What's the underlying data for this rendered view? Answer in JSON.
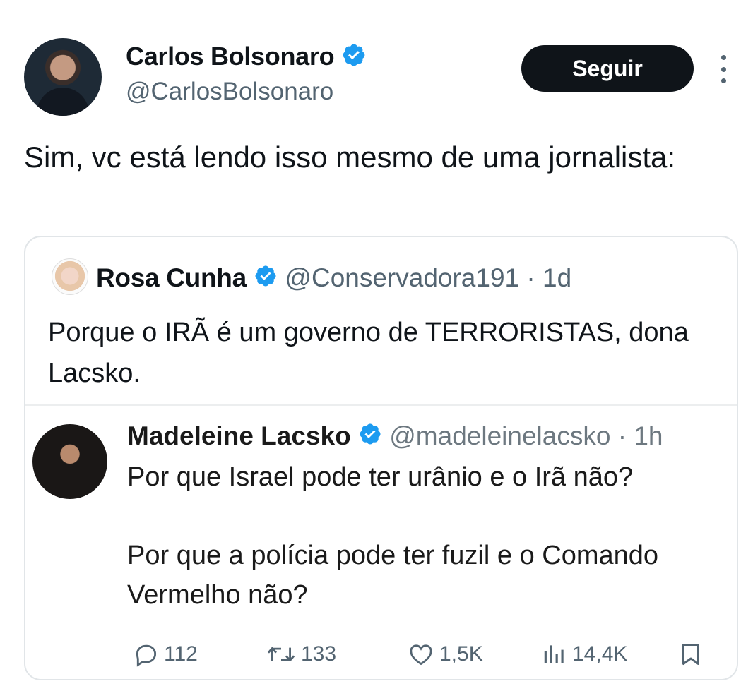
{
  "tweet": {
    "author_name": "Carlos Bolsonaro",
    "author_handle": "@CarlosBolsonaro",
    "follow_label": "Seguir",
    "text": "Sim, vc está lendo isso mesmo de uma jornalista:"
  },
  "quote": {
    "author_name": "Rosa Cunha",
    "author_handle": "@Conservadora191",
    "separator": "·",
    "time": "1d",
    "text": "Porque o IRÃ é um governo de TERRORISTAS, dona Lacsko."
  },
  "embedded": {
    "author_name": "Madeleine Lacsko",
    "author_handle": "@madeleinelacsko",
    "separator": "·",
    "time": "1h",
    "text_1": "Por que Israel pode ter urânio e o Irã não?",
    "text_2": "Por que a polícia pode ter fuzil e o Comando Vermelho não?",
    "actions": {
      "replies": "112",
      "reposts": "133",
      "likes": "1,5K",
      "views": "14,4K"
    }
  },
  "colors": {
    "verified_blue": "#1d9bf0",
    "text_primary": "#0f1419",
    "text_secondary": "#536471",
    "button_bg": "#0f1419"
  },
  "icons": [
    "verified-badge-icon",
    "more-options-icon",
    "reply-icon",
    "repost-icon",
    "like-icon",
    "views-icon",
    "bookmark-icon"
  ]
}
